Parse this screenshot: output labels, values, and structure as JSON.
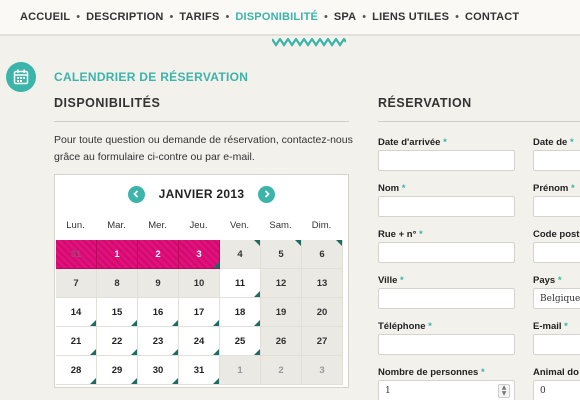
{
  "nav": {
    "items": [
      "ACCUEIL",
      "DESCRIPTION",
      "TARIFS",
      "DISPONIBILITÉ",
      "SPA",
      "LIENS UTILES",
      "CONTACT"
    ],
    "active_index": 3,
    "separator": "•"
  },
  "page": {
    "title": "CALENDRIER DE RÉSERVATION",
    "availability_heading": "DISPONIBILITÉS",
    "reservation_heading": "RÉSERVATION",
    "intro": "Pour toute question ou demande de réservation, contactez-nous grâce au formulaire ci-contre ou par e-mail."
  },
  "calendar": {
    "month_label": "JANVIER 2013",
    "weekdays": [
      "Lun.",
      "Mar.",
      "Mer.",
      "Jeu.",
      "Ven.",
      "Sam.",
      "Dim."
    ],
    "weeks": [
      [
        {
          "d": "31",
          "s": "booked-other"
        },
        {
          "d": "1",
          "s": "booked"
        },
        {
          "d": "2",
          "s": "booked"
        },
        {
          "d": "3",
          "s": "booked"
        },
        {
          "d": "4",
          "s": "weekend"
        },
        {
          "d": "5",
          "s": "weekend"
        },
        {
          "d": "6",
          "s": "weekend"
        }
      ],
      [
        {
          "d": "7",
          "s": "weekend"
        },
        {
          "d": "8",
          "s": "weekend"
        },
        {
          "d": "9",
          "s": "weekend"
        },
        {
          "d": "10",
          "s": "weekend"
        },
        {
          "d": "11",
          "s": "free"
        },
        {
          "d": "12",
          "s": "weekend"
        },
        {
          "d": "13",
          "s": "weekend"
        }
      ],
      [
        {
          "d": "14",
          "s": "free"
        },
        {
          "d": "15",
          "s": "free"
        },
        {
          "d": "16",
          "s": "free"
        },
        {
          "d": "17",
          "s": "free"
        },
        {
          "d": "18",
          "s": "free"
        },
        {
          "d": "19",
          "s": "weekend"
        },
        {
          "d": "20",
          "s": "weekend"
        }
      ],
      [
        {
          "d": "21",
          "s": "free"
        },
        {
          "d": "22",
          "s": "free"
        },
        {
          "d": "23",
          "s": "free"
        },
        {
          "d": "24",
          "s": "free"
        },
        {
          "d": "25",
          "s": "free"
        },
        {
          "d": "26",
          "s": "weekend"
        },
        {
          "d": "27",
          "s": "weekend"
        }
      ],
      [
        {
          "d": "28",
          "s": "free"
        },
        {
          "d": "29",
          "s": "free"
        },
        {
          "d": "30",
          "s": "free"
        },
        {
          "d": "31",
          "s": "free"
        },
        {
          "d": "1",
          "s": "other"
        },
        {
          "d": "2",
          "s": "other"
        },
        {
          "d": "3",
          "s": "other"
        }
      ]
    ],
    "colors": {
      "booked": "#e0117a",
      "accent": "#3bb4aa",
      "marker": "#1d6b63"
    }
  },
  "form": {
    "left": [
      {
        "label": "Date d'arrivée",
        "value": ""
      },
      {
        "label": "Nom",
        "value": ""
      },
      {
        "label": "Rue + n°",
        "value": ""
      },
      {
        "label": "Ville",
        "value": ""
      },
      {
        "label": "Téléphone",
        "value": ""
      },
      {
        "label": "Nombre de personnes",
        "value": "1"
      }
    ],
    "right": [
      {
        "label": "Date de",
        "value": ""
      },
      {
        "label": "Prénom",
        "value": ""
      },
      {
        "label": "Code post",
        "value": ""
      },
      {
        "label": "Pays",
        "value": "Belgique"
      },
      {
        "label": "E-mail",
        "value": ""
      },
      {
        "label": "Animal do",
        "value": "0"
      }
    ],
    "required_mark": "*"
  }
}
